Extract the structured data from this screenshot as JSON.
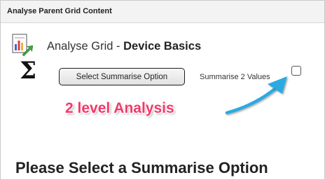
{
  "window": {
    "title": "Analyse Parent Grid Content"
  },
  "header": {
    "prefix": "Analyse Grid - ",
    "name": "Device Basics",
    "icon": "grid-chart-icon"
  },
  "toolbar": {
    "summarise_icon": "Σ",
    "select_button_label": "Select Summarise Option",
    "summarise_two_label": "Summarise 2 Values",
    "summarise_two_checked": false
  },
  "annotation": {
    "text": "2 level Analysis",
    "color": "#ef3a6a",
    "arrow_color": "#29aae1"
  },
  "main": {
    "prompt": "Please Select a Summarise Option"
  }
}
